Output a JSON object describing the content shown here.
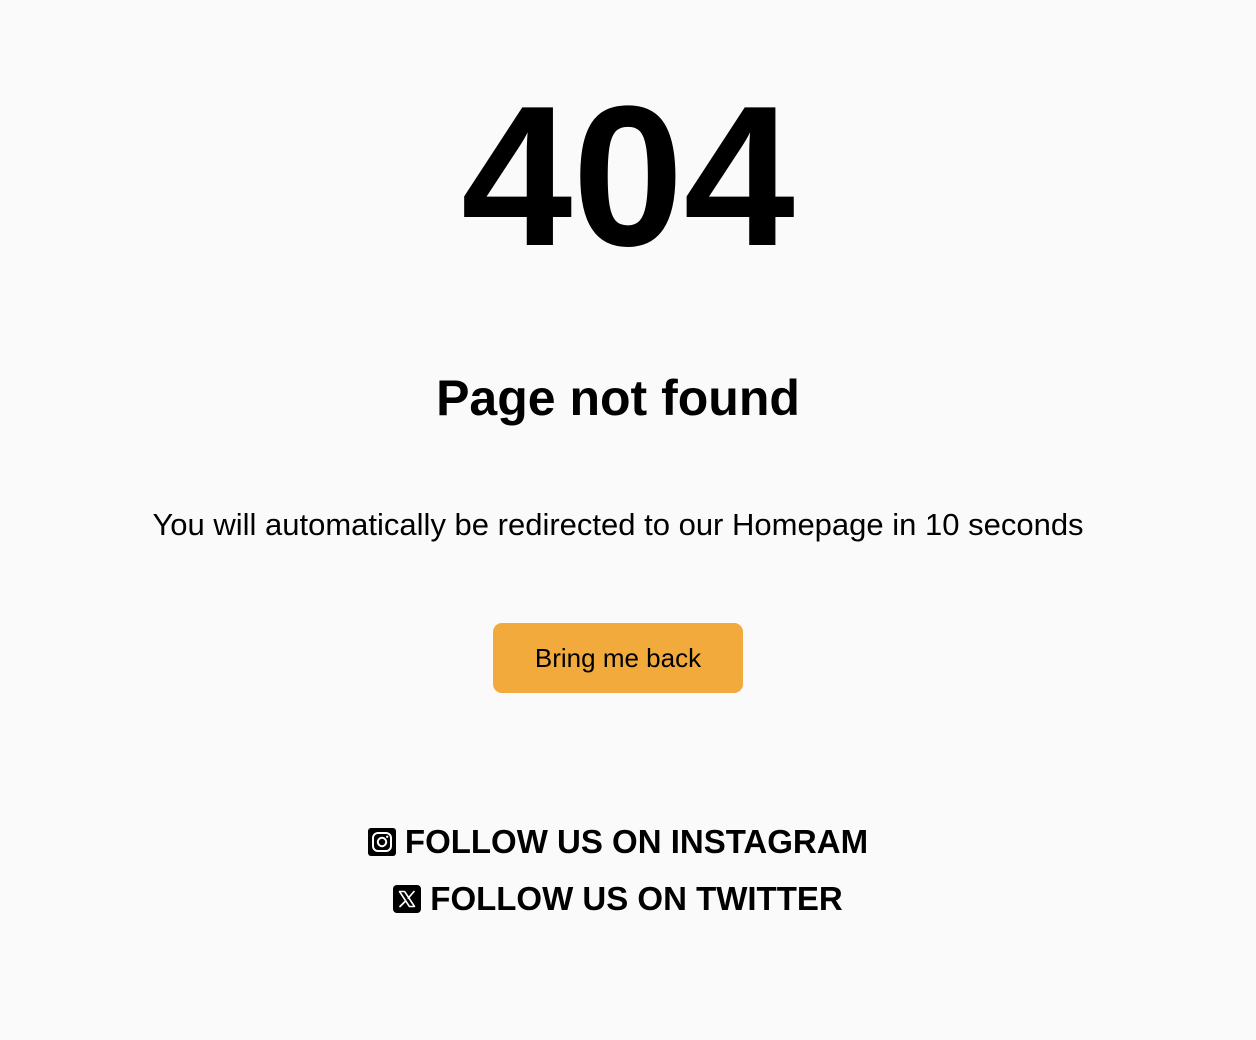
{
  "error": {
    "code": "404",
    "title": "Page not found",
    "message": "You will automatically be redirected to our Homepage in 10 seconds"
  },
  "actions": {
    "back_label": "Bring me back"
  },
  "social": {
    "instagram": {
      "label": "FOLLOW US ON INSTAGRAM",
      "icon": "instagram-icon"
    },
    "twitter": {
      "label": "FOLLOW US ON TWITTER",
      "icon": "x-twitter-icon"
    }
  },
  "colors": {
    "background": "#fafafa",
    "text": "#000000",
    "button": "#f1aa3b"
  }
}
